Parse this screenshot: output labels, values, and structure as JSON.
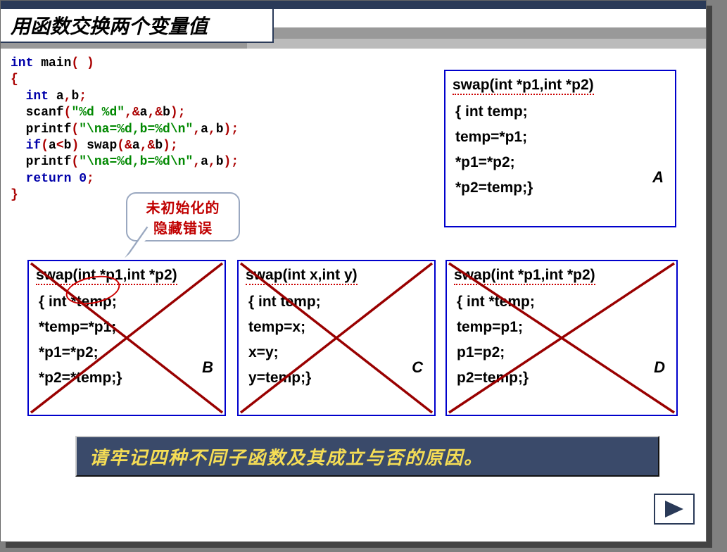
{
  "title": "用函数交换两个变量值",
  "main_code": {
    "l1a": "int",
    "l1b": " main",
    "l1c": "( )",
    "l2": "{",
    "l3a": "  int",
    "l3b": " a",
    "l3c": ",",
    "l3d": "b",
    "l3e": ";",
    "l4a": "  scanf",
    "l4b": "(",
    "l4c": "\"%d %d\"",
    "l4d": ",&",
    "l4e": "a",
    "l4f": ",&",
    "l4g": "b",
    "l4h": ");",
    "l5a": "  printf",
    "l5b": "(",
    "l5c": "\"\\na=%d,b=%d\\n\"",
    "l5d": ",",
    "l5e": "a",
    "l5f": ",",
    "l5g": "b",
    "l5h": ");",
    "l6a": "  if",
    "l6b": "(",
    "l6c": "a",
    "l6d": "<",
    "l6e": "b",
    "l6f": ")",
    "l6g": " swap",
    "l6h": "(&",
    "l6i": "a",
    "l6j": ",&",
    "l6k": "b",
    "l6l": ");",
    "l7a": "  printf",
    "l7b": "(",
    "l7c": "\"\\na=%d,b=%d\\n\"",
    "l7d": ",",
    "l7e": "a",
    "l7f": ",",
    "l7g": "b",
    "l7h": ");",
    "l8a": "  return",
    "l8b": " 0",
    "l8c": ";",
    "l9": "}"
  },
  "callout": {
    "l1": "未初始化的",
    "l2": "隐藏错误"
  },
  "boxA": {
    "sig": "swap(int *p1,int *p2)",
    "l1": "{ int temp;",
    "l2": " temp=*p1;",
    "l3": " *p1=*p2;",
    "l4": " *p2=temp;}",
    "letter": "A"
  },
  "boxB": {
    "sig": "swap(int *p1,int *p2)",
    "l1": "{ int *temp;",
    "l2": " *temp=*p1;",
    "l3": " *p1=*p2;",
    "l4": " *p2=*temp;}",
    "letter": "B"
  },
  "boxC": {
    "sig": "swap(int x,int y)",
    "l1": "{ int temp;",
    "l2": " temp=x;",
    "l3": " x=y;",
    "l4": " y=temp;}",
    "letter": "C"
  },
  "boxD": {
    "sig": "swap(int *p1,int *p2)",
    "l1": "{ int *temp;",
    "l2": " temp=p1;",
    "l3": " p1=p2;",
    "l4": " p2=temp;}",
    "letter": "D"
  },
  "footer": "请牢记四种不同子函数及其成立与否的原因。"
}
